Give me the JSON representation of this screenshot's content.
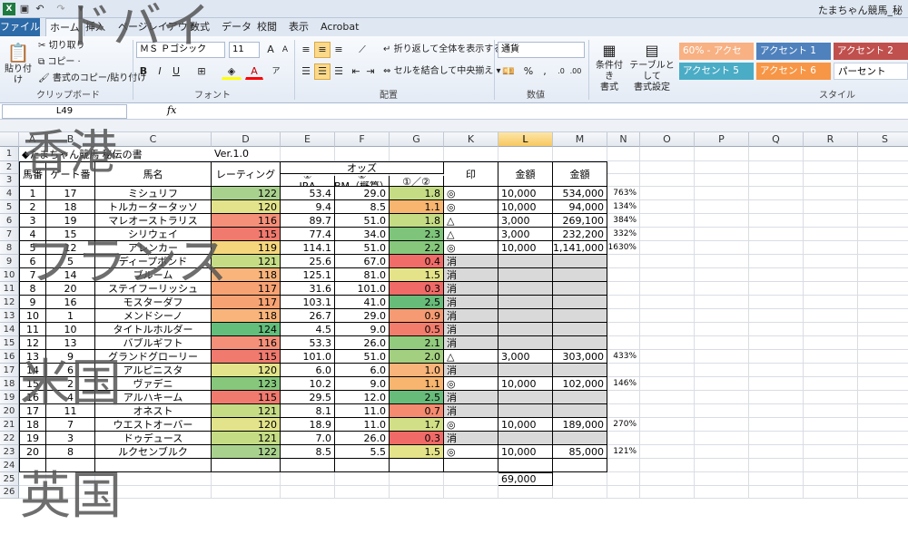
{
  "window": {
    "title": "たまちゃん競馬_秘"
  },
  "quick_access": {
    "icons": [
      "excel-icon",
      "save-icon",
      "undo-icon",
      "redo-icon",
      "customize-icon"
    ]
  },
  "tabs": {
    "file": "ファイル",
    "items": [
      "ホーム",
      "挿入",
      "ページレイアウト",
      "数式",
      "データ",
      "校閲",
      "表示",
      "Acrobat"
    ],
    "active_index": 0
  },
  "ribbon": {
    "clipboard": {
      "paste": "貼り付け",
      "cut": "切り取り",
      "copy": "コピー ·",
      "format_painter": "書式のコピー/貼り付け",
      "group": "クリップボード"
    },
    "font": {
      "name": "ＭＳ Ｐゴシック",
      "size": "11",
      "bold": "B",
      "italic": "I",
      "underline": "U",
      "group": "フォント"
    },
    "alignment": {
      "wrap": "折り返して全体を表示する",
      "merge": "セルを結合して中央揃え",
      "group": "配置"
    },
    "number": {
      "format": "通貨",
      "group": "数値"
    },
    "styles": {
      "conditional": "条件付き",
      "conditional2": "書式",
      "table": "テーブルとして",
      "table2": "書式設定",
      "group": "スタイル",
      "cells": [
        {
          "label": "60% - アクセ",
          "color": "#f8b183"
        },
        {
          "label": "アクセント 1",
          "color": "#4f81bd"
        },
        {
          "label": "アクセント 2",
          "color": "#c0504d"
        },
        {
          "label": "アクセント 5",
          "color": "#4bacc6"
        },
        {
          "label": "アクセント 6",
          "color": "#f79646"
        },
        {
          "label": "パーセント",
          "color": "#ffffff"
        }
      ]
    }
  },
  "formula_bar": {
    "name_box": "L49",
    "fx": "fx"
  },
  "sheet": {
    "columns": [
      "A",
      "B",
      "C",
      "D",
      "E",
      "F",
      "G",
      "K",
      "L",
      "M",
      "N",
      "O",
      "P",
      "Q",
      "R",
      "S"
    ],
    "selected_column": "L",
    "row_numbers": [
      "1",
      "2",
      "3",
      "4",
      "5",
      "6",
      "7",
      "8",
      "9",
      "10",
      "11",
      "12",
      "13",
      "14",
      "15",
      "16",
      "17",
      "18",
      "19",
      "20",
      "21",
      "22",
      "23",
      "24",
      "25",
      "26"
    ],
    "title": "◆たまちゃん競馬 秘伝の書",
    "version": "Ver.1.0",
    "headers": {
      "umaban": "馬番",
      "gate": "ゲート番",
      "name": "馬名",
      "rating": "レーティング",
      "odds": "オッズ",
      "jra_num": "①",
      "jra": "JRA",
      "bm_num": "②",
      "bm": "BM（概算）",
      "ratio": "①／②",
      "mark": "印",
      "amount1": "金額",
      "amount2": "金額"
    },
    "rows": [
      {
        "n": "1",
        "g": "17",
        "name": "ミシュリフ",
        "rating": "122",
        "jra": "53.4",
        "bm": "29.0",
        "ratio": "1.8",
        "mark": "◎",
        "a1": "10,000",
        "a2": "534,000",
        "pct": "763%",
        "rc": "#a9d18e",
        "gc": "#c5dc85"
      },
      {
        "n": "2",
        "g": "18",
        "name": "トルカータータッソ",
        "rating": "120",
        "jra": "9.4",
        "bm": "8.5",
        "ratio": "1.1",
        "mark": "◎",
        "a1": "10,000",
        "a2": "94,000",
        "pct": "134%",
        "rc": "#e2e38a",
        "gc": "#f7b56f"
      },
      {
        "n": "3",
        "g": "19",
        "name": "マレオーストラリス",
        "rating": "116",
        "jra": "89.7",
        "bm": "51.0",
        "ratio": "1.8",
        "mark": "△",
        "a1": "3,000",
        "a2": "269,100",
        "pct": "384%",
        "rc": "#f48f79",
        "gc": "#c5dc85"
      },
      {
        "n": "4",
        "g": "15",
        "name": "シリウェイ",
        "rating": "115",
        "jra": "77.4",
        "bm": "34.0",
        "ratio": "2.3",
        "mark": "△",
        "a1": "3,000",
        "a2": "232,200",
        "pct": "332%",
        "rc": "#f07a6e",
        "gc": "#7ec47b"
      },
      {
        "n": "5",
        "g": "12",
        "name": "アレンカー",
        "rating": "119",
        "jra": "114.1",
        "bm": "51.0",
        "ratio": "2.2",
        "mark": "◎",
        "a1": "10,000",
        "a2": "1,141,000",
        "pct": "1630%",
        "rc": "#f5d67d",
        "gc": "#86c77c"
      },
      {
        "n": "6",
        "g": "5",
        "name": "ディープボンド",
        "rating": "121",
        "jra": "25.6",
        "bm": "67.0",
        "ratio": "0.4",
        "mark": "消",
        "a1": "",
        "a2": "",
        "pct": "",
        "rc": "#c5dc85",
        "gc": "#f06c68"
      },
      {
        "n": "7",
        "g": "14",
        "name": "ブルーム",
        "rating": "118",
        "jra": "125.1",
        "bm": "81.0",
        "ratio": "1.5",
        "mark": "消",
        "a1": "",
        "a2": "",
        "pct": "",
        "rc": "#f8b47a",
        "gc": "#e4e38a"
      },
      {
        "n": "8",
        "g": "20",
        "name": "ステイフーリッシュ",
        "rating": "117",
        "jra": "31.6",
        "bm": "101.0",
        "ratio": "0.3",
        "mark": "消",
        "a1": "",
        "a2": "",
        "pct": "",
        "rc": "#f6a273",
        "gc": "#f06a68"
      },
      {
        "n": "9",
        "g": "16",
        "name": "モスターダフ",
        "rating": "117",
        "jra": "103.1",
        "bm": "41.0",
        "ratio": "2.5",
        "mark": "消",
        "a1": "",
        "a2": "",
        "pct": "",
        "rc": "#f6a273",
        "gc": "#68bc7a"
      },
      {
        "n": "10",
        "g": "1",
        "name": "メンドシーノ",
        "rating": "118",
        "jra": "26.7",
        "bm": "29.0",
        "ratio": "0.9",
        "mark": "消",
        "a1": "",
        "a2": "",
        "pct": "",
        "rc": "#f8b47a",
        "gc": "#f59a72"
      },
      {
        "n": "11",
        "g": "10",
        "name": "タイトルホルダー",
        "rating": "124",
        "jra": "4.5",
        "bm": "9.0",
        "ratio": "0.5",
        "mark": "消",
        "a1": "",
        "a2": "",
        "pct": "",
        "rc": "#63be7b",
        "gc": "#f27d6d"
      },
      {
        "n": "12",
        "g": "13",
        "name": "バブルギフト",
        "rating": "116",
        "jra": "53.3",
        "bm": "26.0",
        "ratio": "2.1",
        "mark": "消",
        "a1": "",
        "a2": "",
        "pct": "",
        "rc": "#f48f79",
        "gc": "#92cb7d"
      },
      {
        "n": "13",
        "g": "9",
        "name": "グランドグローリー",
        "rating": "115",
        "jra": "101.0",
        "bm": "51.0",
        "ratio": "2.0",
        "mark": "△",
        "a1": "3,000",
        "a2": "303,000",
        "pct": "433%",
        "rc": "#f07a6e",
        "gc": "#a3d080"
      },
      {
        "n": "14",
        "g": "6",
        "name": "アルピニスタ",
        "rating": "120",
        "jra": "6.0",
        "bm": "6.0",
        "ratio": "1.0",
        "mark": "消",
        "a1": "",
        "a2": "",
        "pct": "",
        "rc": "#e2e38a",
        "gc": "#f8b47a"
      },
      {
        "n": "15",
        "g": "2",
        "name": "ヴァデニ",
        "rating": "123",
        "jra": "10.2",
        "bm": "9.0",
        "ratio": "1.1",
        "mark": "◎",
        "a1": "10,000",
        "a2": "102,000",
        "pct": "146%",
        "rc": "#86c77c",
        "gc": "#f7b56f"
      },
      {
        "n": "16",
        "g": "4",
        "name": "アルハキーム",
        "rating": "115",
        "jra": "29.5",
        "bm": "12.0",
        "ratio": "2.5",
        "mark": "消",
        "a1": "",
        "a2": "",
        "pct": "",
        "rc": "#f07a6e",
        "gc": "#68bc7a"
      },
      {
        "n": "17",
        "g": "11",
        "name": "オネスト",
        "rating": "121",
        "jra": "8.1",
        "bm": "11.0",
        "ratio": "0.7",
        "mark": "消",
        "a1": "",
        "a2": "",
        "pct": "",
        "rc": "#c5dc85",
        "gc": "#f48a6f"
      },
      {
        "n": "18",
        "g": "7",
        "name": "ウエストオーバー",
        "rating": "120",
        "jra": "18.9",
        "bm": "11.0",
        "ratio": "1.7",
        "mark": "◎",
        "a1": "10,000",
        "a2": "189,000",
        "pct": "270%",
        "rc": "#e2e38a",
        "gc": "#d1df87"
      },
      {
        "n": "19",
        "g": "3",
        "name": "ドゥデュース",
        "rating": "121",
        "jra": "7.0",
        "bm": "26.0",
        "ratio": "0.3",
        "mark": "消",
        "a1": "",
        "a2": "",
        "pct": "",
        "rc": "#c5dc85",
        "gc": "#f06a68"
      },
      {
        "n": "20",
        "g": "8",
        "name": "ルクセンブルク",
        "rating": "122",
        "jra": "8.5",
        "bm": "5.5",
        "ratio": "1.5",
        "mark": "◎",
        "a1": "10,000",
        "a2": "85,000",
        "pct": "121%",
        "rc": "#a9d18e",
        "gc": "#e4e38a"
      }
    ],
    "total": "69,000",
    "mark_bg": "#d9d9d9"
  },
  "overlay_text": [
    "ドバイ",
    "香港",
    "フランス",
    "米国",
    "英国"
  ]
}
